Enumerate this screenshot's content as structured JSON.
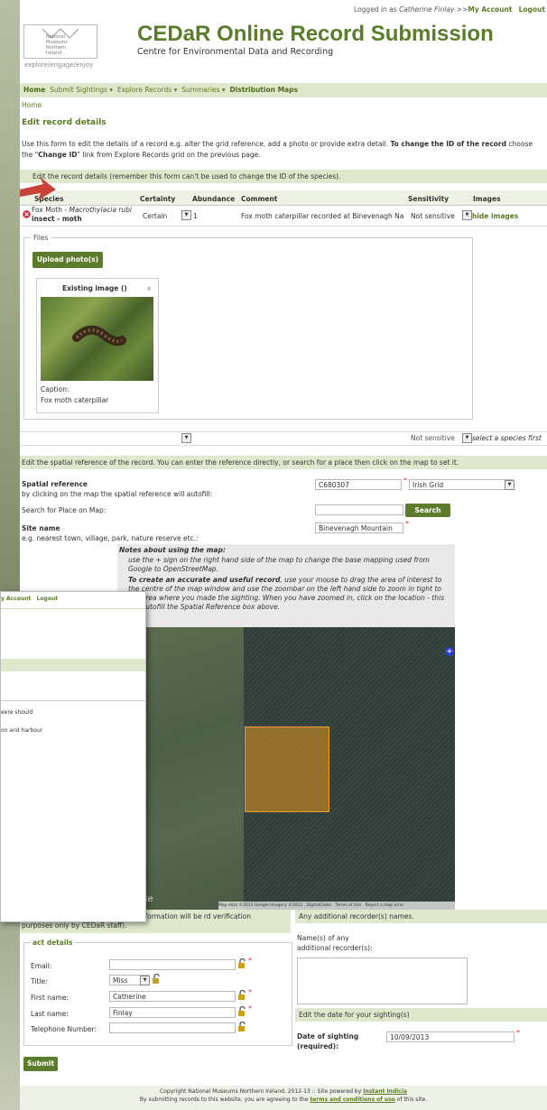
{
  "header": {
    "logged_in_prefix": "Logged in as",
    "user_name": "Catherine Finlay",
    "separator": ">>",
    "my_account": "My Account",
    "logout": "Logout",
    "logo_lines": [
      "National",
      "Museums",
      "Northern",
      "Ireland"
    ],
    "logo_tagline": "explore/engage/enjoy",
    "title": "CEDaR Online Record Submission",
    "subtitle": "Centre for Environmental Data and Recording"
  },
  "nav": {
    "items": [
      "Home",
      "Submit Sightings ▾",
      "Explore Records ▾",
      "Summaries ▾",
      "Distribution Maps"
    ],
    "breadcrumb": "Home"
  },
  "page": {
    "heading": "Edit record details",
    "intro_1": "Use this form to edit the details of a record e.g. alter the grid reference, add a photo or provide extra detail.",
    "intro_bold": "To change the ID of the record",
    "intro_tail": "choose",
    "intro_2_pre": "the \"",
    "intro_2_bold": "Change ID",
    "intro_2_post": "\" link from Explore Records grid on the previous page.",
    "record_bar": "Edit the record details (remember this form can't be used to change the ID of the species)."
  },
  "table": {
    "headers": [
      "Species",
      "Certainty",
      "Abundance",
      "Comment",
      "Sensitivity",
      "Images"
    ],
    "row": {
      "species_common": "Fox Moth - ",
      "species_latin": "Macrothylacia rubi",
      "species_group": "insect - moth",
      "certainty": "Certain",
      "abundance": "1",
      "comment": "Fox moth caterpillar recorded at Binevenagh Na",
      "sensitivity": "Not sensitive",
      "images_link": "hide images"
    },
    "files_legend": "Files",
    "upload_button": "Upload photo(s)",
    "existing_image_title": "Existing image ()",
    "close": "x",
    "caption_label": "Caption:",
    "caption_value": "Fox moth caterpillar",
    "empty_row_sensitivity": "Not sensitive",
    "empty_row_hint": "select a species first"
  },
  "spatial": {
    "bar": "Edit the spatial reference of the record. You can enter the reference directly, or search for a place then click on the map to set it.",
    "label": "Spatial reference",
    "hint": "by clicking on the map the spatial reference will autofill:",
    "value": "C680307",
    "system": "Irish Grid",
    "search_label": "Search for Place on Map:",
    "search_button": "Search",
    "site_label": "Site name",
    "site_hint": "e.g. nearest town, village, park, nature reserve etc.:",
    "site_value": "Binevenagh Mountain"
  },
  "map_notes": {
    "title": "Notes about using the map:",
    "note1": "use the + sign on the right hand side of the map to change the base mapping used from Google to OpenStreetMap.",
    "note2_bold": "To create an accurate and useful record",
    "note2": ", use your mouse to drag the area of interest to the centre of the map window and use the zoombar on the left hand side to zoom in tight to the area where you made the sighting. When you have zoomed in, click on the location - this will autofill the Spatial Reference box above.",
    "google": "Google",
    "attribution": "Map data ©2013 Google Imagery ©2013 , DigitalGlobe",
    "terms": "Terms of Use",
    "report": "Report a map error"
  },
  "contact": {
    "bar": "de your contact details (note: this information will be rd verification purposes only by CEDaR staff).",
    "legend": "act details",
    "fields": [
      {
        "label": "Email:",
        "value": ""
      },
      {
        "label": "Title:",
        "value": "Miss"
      },
      {
        "label": "First name:",
        "value": "Catherine"
      },
      {
        "label": "Last name:",
        "value": "Finlay"
      },
      {
        "label": "Telephone Number:",
        "value": ""
      }
    ]
  },
  "recorders": {
    "bar": "Any additional recorder(s) names.",
    "label_1": "Name(s) of any",
    "label_2": "additional recorder(s):"
  },
  "date": {
    "bar": "Edit the date for your sighting(s)",
    "label_1": "Date of sighting",
    "label_2": "(required):",
    "value": "10/09/2013"
  },
  "submit": "Submit",
  "footer": {
    "line1_pre": "Copyright National Museums Northern Ireland, 2012-13 :: Site powered by",
    "line1_link": "Instant Indicia",
    "line2_pre": "By submitting records to this website, you are agreeing to the",
    "line2_link": "terms and conditions of use",
    "line2_post": "of this site."
  },
  "overlay": {
    "account": "y Account",
    "logout": "Logout",
    "line1": "eere should",
    "line2": "on and harbour"
  }
}
